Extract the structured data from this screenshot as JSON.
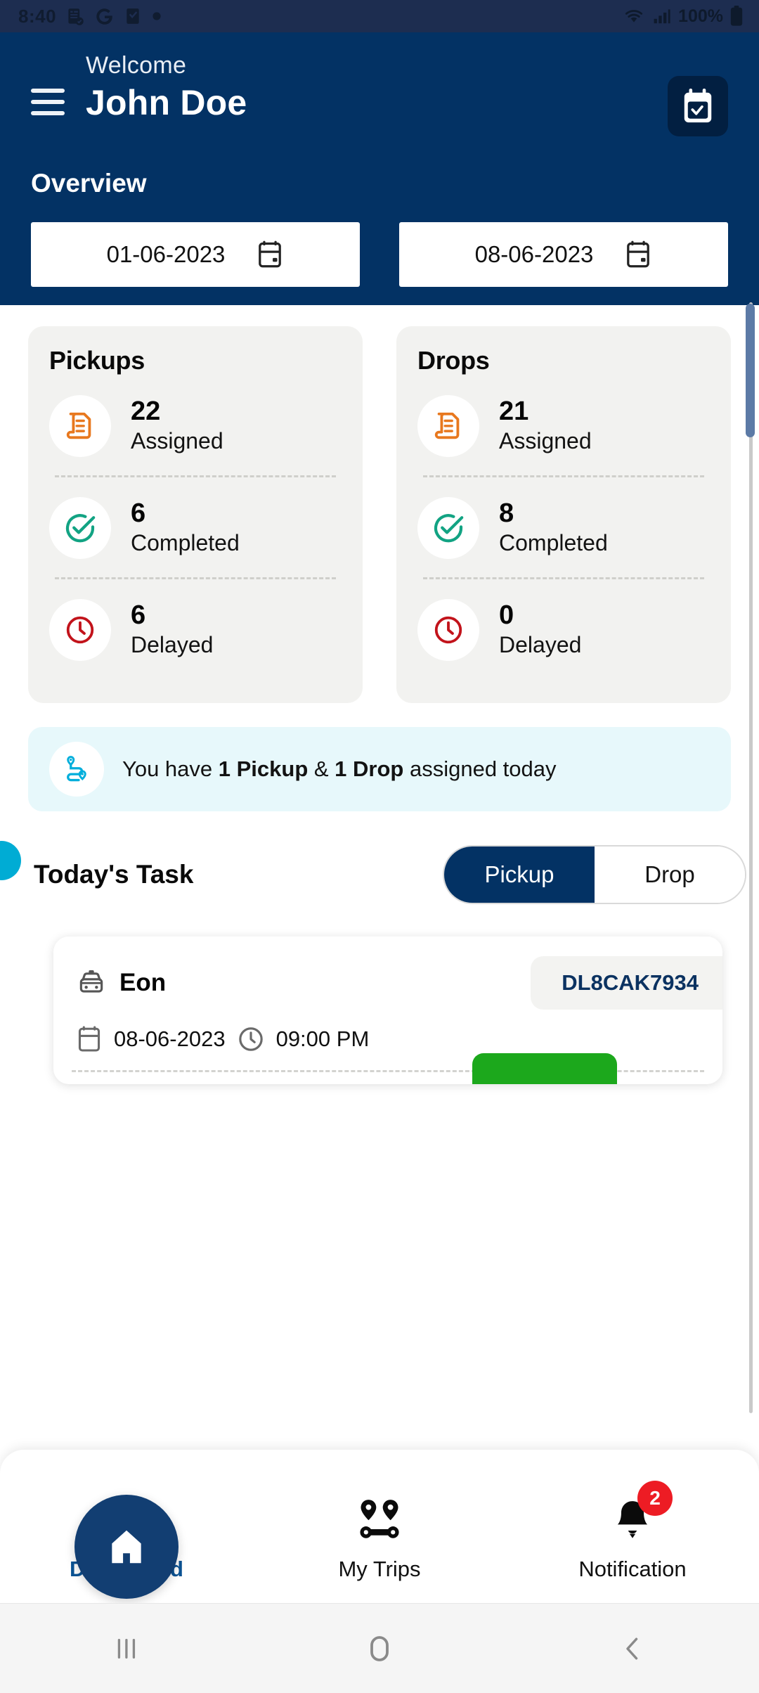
{
  "status_bar": {
    "time": "8:40",
    "battery_text": "100%",
    "icons": [
      "notes-icon",
      "google-icon",
      "checkbox-icon",
      "dot-icon",
      "wifi-icon",
      "signal-icon",
      "battery-icon"
    ]
  },
  "header": {
    "welcome_label": "Welcome",
    "user_name": "John Doe",
    "menu_icon": "hamburger-icon",
    "calendar_button_icon": "calendar-check-icon",
    "section_title": "Overview",
    "date_from": "01-06-2023",
    "date_to": "08-06-2023",
    "date_icon": "calendar-icon",
    "bg_color": "#033264"
  },
  "stats": [
    {
      "title": "Pickups",
      "rows": [
        {
          "count": "22",
          "label": "Assigned",
          "icon": "document-icon",
          "color": "#E8781E"
        },
        {
          "count": "6",
          "label": "Completed",
          "icon": "check-circle-icon",
          "color": "#12A383"
        },
        {
          "count": "6",
          "label": "Delayed",
          "icon": "clock-icon",
          "color": "#C2131B"
        }
      ]
    },
    {
      "title": "Drops",
      "rows": [
        {
          "count": "21",
          "label": "Assigned",
          "icon": "document-icon",
          "color": "#E8781E"
        },
        {
          "count": "8",
          "label": "Completed",
          "icon": "check-circle-icon",
          "color": "#12A383"
        },
        {
          "count": "0",
          "label": "Delayed",
          "icon": "clock-icon",
          "color": "#C2131B"
        }
      ]
    }
  ],
  "banner": {
    "icon": "route-icon",
    "prefix": "You have ",
    "bold1": "1 Pickup",
    "middle": " & ",
    "bold2": "1 Drop",
    "suffix": " assigned today",
    "bg_color": "#E7F8FB"
  },
  "todays_task": {
    "title": "Today's Task",
    "accent_color": "#00ACD4",
    "toggle": {
      "selected": "Pickup",
      "options": [
        "Pickup",
        "Drop"
      ]
    }
  },
  "task_card": {
    "vehicle_icon": "car-icon",
    "vehicle_name": "Eon",
    "plate": "DL8CAK7934",
    "date_icon": "calendar-icon",
    "date": "08-06-2023",
    "time_icon": "clock-icon",
    "time": "09:00 PM",
    "action_button_color": "#1CA81C"
  },
  "bottom_nav": {
    "items": [
      {
        "label": "Dashboard",
        "icon": "home-icon",
        "active": true,
        "badge": ""
      },
      {
        "label": "My Trips",
        "icon": "trip-pins-icon",
        "active": false,
        "badge": ""
      },
      {
        "label": "Notification",
        "icon": "bell-icon",
        "active": false,
        "badge": "2"
      }
    ],
    "active_color": "#0b5394",
    "badge_color": "#ED1C24"
  },
  "system_nav": {
    "recents_icon": "recents-icon",
    "home_icon": "home-circle-icon",
    "back_icon": "back-chevron-icon"
  }
}
